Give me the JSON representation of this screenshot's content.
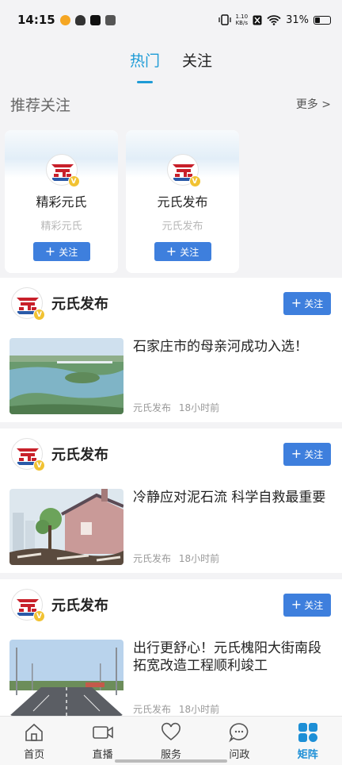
{
  "status": {
    "time": "14:15",
    "net_speed_value": "1.10",
    "net_speed_unit": "KB/s",
    "battery": "31%"
  },
  "tabs": [
    {
      "label": "热门",
      "active": true
    },
    {
      "label": "关注",
      "active": false
    }
  ],
  "recommend": {
    "title": "推荐关注",
    "more": "更多 >",
    "cards": [
      {
        "name": "精彩元氏",
        "sub": "精彩元氏",
        "button": "关注"
      },
      {
        "name": "元氏发布",
        "sub": "元氏发布",
        "button": "关注"
      }
    ]
  },
  "posts": [
    {
      "account": "元氏发布",
      "follow": "关注",
      "title": "石家庄市的母亲河成功入选！",
      "source": "元氏发布",
      "time": "18小时前",
      "thumb": "river-aerial"
    },
    {
      "account": "元氏发布",
      "follow": "关注",
      "title": "冷静应对泥石流 科学自救最重要",
      "source": "元氏发布",
      "time": "18小时前",
      "thumb": "mudflow-illustration"
    },
    {
      "account": "元氏发布",
      "follow": "关注",
      "title": "出行更舒心！元氏槐阳大街南段拓宽改造工程顺利竣工",
      "source": "元氏发布",
      "time": "18小时前",
      "thumb": "road-street"
    }
  ],
  "nav": [
    {
      "label": "首页",
      "icon": "home-icon",
      "active": false
    },
    {
      "label": "直播",
      "icon": "video-icon",
      "active": false
    },
    {
      "label": "服务",
      "icon": "heart-icon",
      "active": false
    },
    {
      "label": "问政",
      "icon": "chat-icon",
      "active": false
    },
    {
      "label": "矩阵",
      "icon": "grid-icon",
      "active": true
    }
  ],
  "colors": {
    "accent": "#1d9bd6",
    "button": "#3e7fdd",
    "badge": "#f1c232",
    "logo_red": "#c8202a"
  }
}
